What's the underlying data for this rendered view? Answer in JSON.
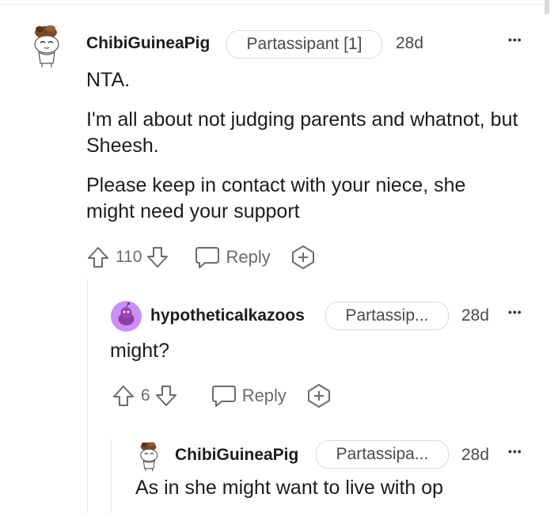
{
  "comments": [
    {
      "username": "ChibiGuineaPig",
      "flair": "Partassipant [1]",
      "age": "28d",
      "more": "•••",
      "paragraphs": [
        "NTA.",
        "I'm all about not judging parents and whatnot, but Sheesh.",
        "Please keep in contact with your niece, she might need your support"
      ],
      "votes": "110",
      "reply_label": "Reply"
    },
    {
      "username": "hypotheticalkazoos",
      "flair": "Partassip...",
      "age": "28d",
      "more": "•••",
      "paragraphs": [
        "might?"
      ],
      "votes": "6",
      "reply_label": "Reply"
    },
    {
      "username": "ChibiGuineaPig",
      "flair": "Partassipa...",
      "age": "28d",
      "more": "•••",
      "paragraphs": [
        "As in she might want to live with op"
      ]
    }
  ],
  "icons": {
    "upvote": "arrow-up-icon",
    "downvote": "arrow-down-icon",
    "reply": "speech-bubble-icon",
    "award": "plus-award-icon",
    "more": "more-options-icon"
  },
  "colors": {
    "text": "#1c1c1c",
    "muted": "#6b6b6b",
    "flair_border": "#dadada",
    "avatar_bg_purple": "#c98ff5"
  }
}
